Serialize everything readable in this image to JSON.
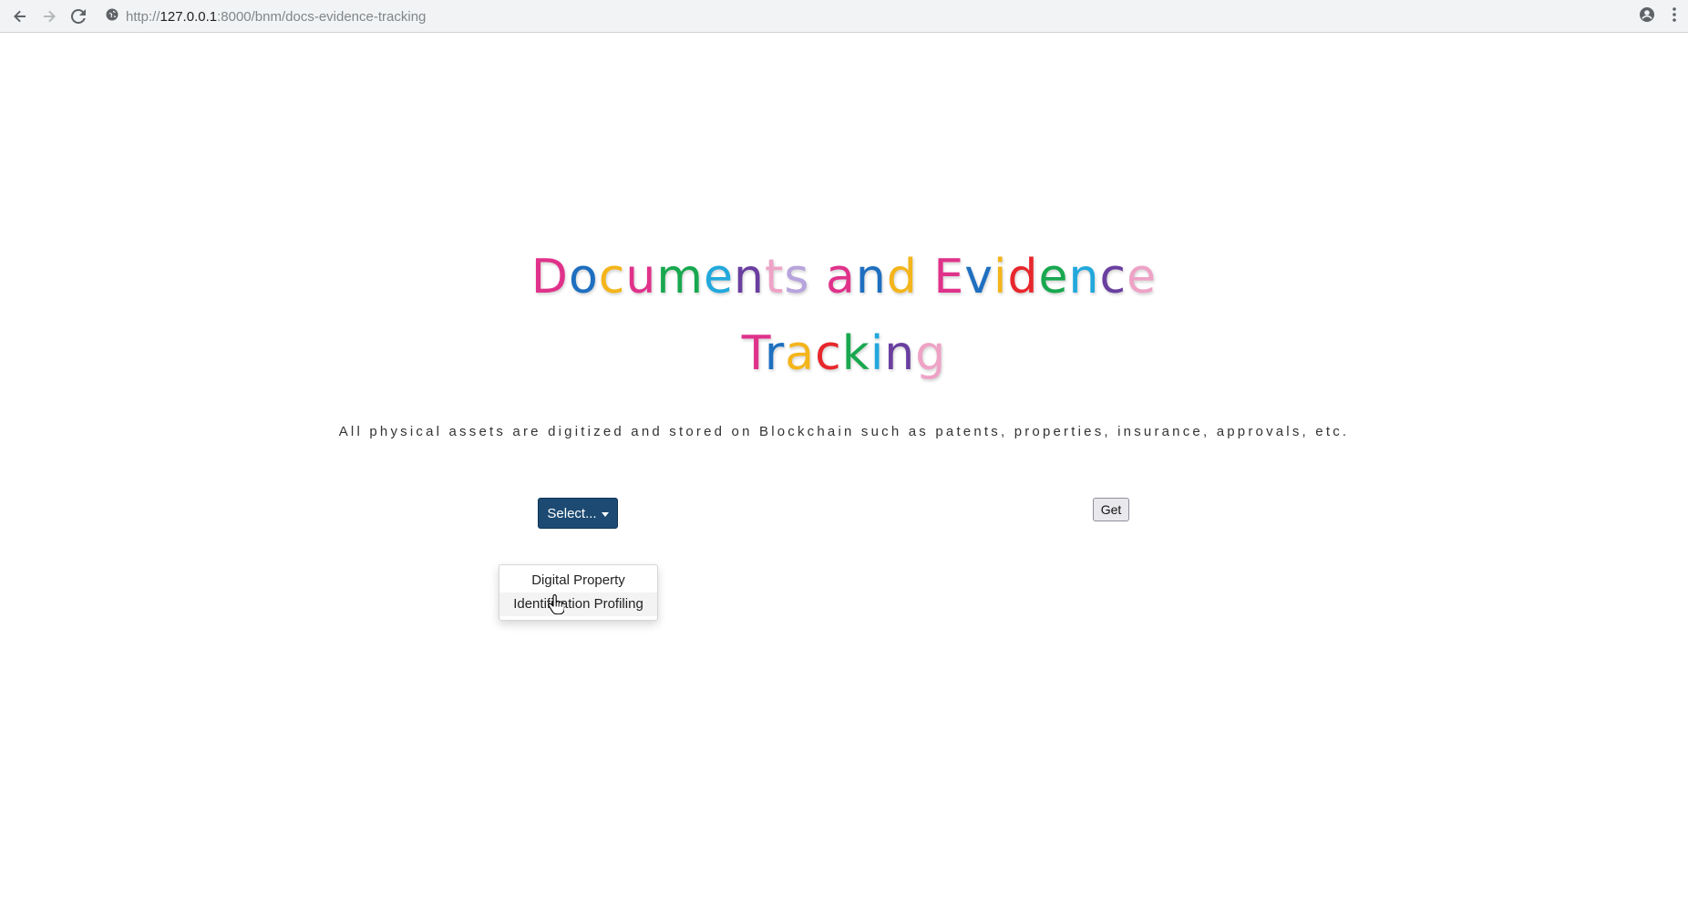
{
  "browser": {
    "url_scheme": "http://",
    "url_host": "127.0.0.1",
    "url_path": ":8000/bnm/docs-evidence-tracking",
    "icons": [
      "back-arrow-icon",
      "forward-arrow-icon",
      "reload-icon",
      "site-info-icon",
      "account-icon",
      "menu-dots-icon"
    ]
  },
  "page": {
    "title_line1": [
      {
        "ch": "D",
        "color": "#e0328a"
      },
      {
        "ch": "o",
        "color": "#1e6fc0"
      },
      {
        "ch": "c",
        "color": "#f4b51b"
      },
      {
        "ch": "u",
        "color": "#e0328a"
      },
      {
        "ch": "m",
        "color": "#18a84f"
      },
      {
        "ch": "e",
        "color": "#22a8dc"
      },
      {
        "ch": "n",
        "color": "#6a3fa0"
      },
      {
        "ch": "t",
        "color": "#eea3c6"
      },
      {
        "ch": "s",
        "color": "#b7a4dd"
      },
      {
        "ch": " ",
        "color": "#000000"
      },
      {
        "ch": "a",
        "color": "#e0328a"
      },
      {
        "ch": "n",
        "color": "#1e6fc0"
      },
      {
        "ch": "d",
        "color": "#f4b51b"
      },
      {
        "ch": " ",
        "color": "#000000"
      },
      {
        "ch": "E",
        "color": "#e0328a"
      },
      {
        "ch": "v",
        "color": "#1e6fc0"
      },
      {
        "ch": "i",
        "color": "#f4b51b"
      },
      {
        "ch": "d",
        "color": "#e8272c"
      },
      {
        "ch": "e",
        "color": "#18a84f"
      },
      {
        "ch": "n",
        "color": "#22a8dc"
      },
      {
        "ch": "c",
        "color": "#6a3fa0"
      },
      {
        "ch": "e",
        "color": "#eea3c6"
      }
    ],
    "title_line2": [
      {
        "ch": "T",
        "color": "#e0328a"
      },
      {
        "ch": "r",
        "color": "#1e6fc0"
      },
      {
        "ch": "a",
        "color": "#f4b51b"
      },
      {
        "ch": "c",
        "color": "#e8272c"
      },
      {
        "ch": "k",
        "color": "#18a84f"
      },
      {
        "ch": "i",
        "color": "#22a8dc"
      },
      {
        "ch": "n",
        "color": "#6a3fa0"
      },
      {
        "ch": "g",
        "color": "#eea3c6"
      }
    ],
    "subtitle": "All physical assets are digitized and stored on Blockchain such as patents, properties, insurance, approvals, etc.",
    "select_label": "Select...",
    "get_label": "Get",
    "dropdown_items": [
      "Digital Property",
      "Identification Profiling"
    ],
    "hovered_item_index": 1
  },
  "colors": {
    "select_button_bg": "#1c4a72",
    "browser_bar_bg": "#f1f3f4"
  }
}
